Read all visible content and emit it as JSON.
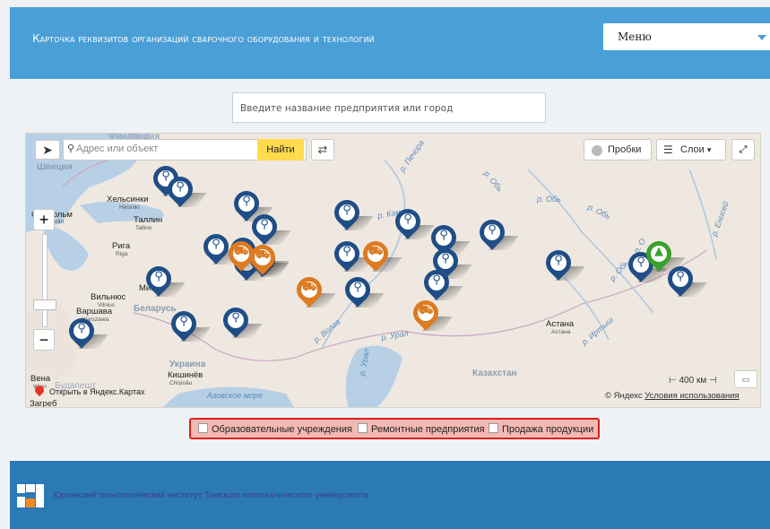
{
  "header": {
    "title": "Карточка реквизитов организаций сварочного оборудования и технологий",
    "menu_label": "Меню"
  },
  "search": {
    "placeholder": "Введите название предприятия или город"
  },
  "map": {
    "address_placeholder": "Адрес или объект",
    "find_button": "Найти",
    "traffic_button": "Пробки",
    "layers_button": "Слои",
    "scale_label": "400 км",
    "open_in_yandex": "Открыть в Яндекс.Картах",
    "copyright": "© Яндекс",
    "terms_link": "Условия использования",
    "labels": {
      "finland": "Финляндия",
      "sweden": "Швеция",
      "helsinki": "Хельсинки",
      "helsinki_sub": "Helsinki",
      "stockholm": "Стокгольм",
      "stockholm_sub": "Stockholm",
      "tallinn": "Таллин",
      "tallinn_sub": "Tallinn",
      "riga": "Рига",
      "riga_sub": "Riga",
      "vilnius": "Вильнюс",
      "vilnius_sub": "Vilnius",
      "warsaw": "Варшава",
      "warsaw_sub": "Warszawa",
      "minsk": "Минск",
      "belarus": "Беларусь",
      "ukraine": "Украина",
      "kishinev": "Кишинёв",
      "kishinev_sub": "Chișinău",
      "vienna": "Вена",
      "vienna_sub": "Wien",
      "budapest": "Будапешт",
      "zagreb": "Загреб",
      "kazakhstan": "Казахстан",
      "astana": "Астана",
      "astana_sub": "Астана",
      "azov": "Азовское море",
      "r_pechora": "р. Печора",
      "r_kama": "р. Кама",
      "r_volga": "р. Волга",
      "r_ural": "р. Урал",
      "r_ural2": "р. Урал",
      "r_ob1": "р. Обь",
      "r_ob2": "р. Обь",
      "r_ob3": "р. Обь",
      "r_ob4": "р. Обь",
      "r_irtysh": "р. Иртыш",
      "r_yenisei": "р. Енисей",
      "r_ob_partial": "р. О"
    },
    "marker_colors": {
      "repair": "#1f4e86",
      "sales": "#dd7a22",
      "education": "#3aa12c"
    },
    "markers": [
      {
        "type": "repair",
        "icon": "wrench-icon"
      },
      {
        "type": "repair",
        "icon": "wrench-icon"
      },
      {
        "type": "repair",
        "icon": "wrench-icon"
      },
      {
        "type": "repair",
        "icon": "wrench-icon"
      },
      {
        "type": "repair",
        "icon": "wrench-icon"
      },
      {
        "type": "repair",
        "icon": "wrench-icon"
      },
      {
        "type": "repair",
        "icon": "wrench-icon"
      },
      {
        "type": "repair",
        "icon": "wrench-icon"
      },
      {
        "type": "sales",
        "icon": "cart-icon"
      },
      {
        "type": "sales",
        "icon": "cart-icon"
      },
      {
        "type": "repair",
        "icon": "wrench-icon"
      },
      {
        "type": "repair",
        "icon": "wrench-icon"
      },
      {
        "type": "repair",
        "icon": "wrench-icon"
      },
      {
        "type": "repair",
        "icon": "wrench-icon"
      },
      {
        "type": "sales",
        "icon": "cart-icon"
      },
      {
        "type": "sales",
        "icon": "cart-icon"
      },
      {
        "type": "repair",
        "icon": "wrench-icon"
      },
      {
        "type": "repair",
        "icon": "wrench-icon"
      },
      {
        "type": "repair",
        "icon": "wrench-icon"
      },
      {
        "type": "repair",
        "icon": "wrench-icon"
      },
      {
        "type": "repair",
        "icon": "wrench-icon"
      },
      {
        "type": "repair",
        "icon": "wrench-icon"
      },
      {
        "type": "repair",
        "icon": "wrench-icon"
      },
      {
        "type": "sales",
        "icon": "cart-icon"
      },
      {
        "type": "repair",
        "icon": "wrench-icon"
      },
      {
        "type": "repair",
        "icon": "wrench-icon"
      },
      {
        "type": "repair",
        "icon": "wrench-icon"
      },
      {
        "type": "education",
        "icon": "graduation-cap-icon"
      },
      {
        "type": "repair",
        "icon": "wrench-icon"
      }
    ]
  },
  "legend": {
    "education": "Образовательные учреждения",
    "repair": "Ремонтные предприятия",
    "sales": "Продажа продукции"
  },
  "footer": {
    "text": "Юргинский технологический институт Томского политехнического университета"
  }
}
